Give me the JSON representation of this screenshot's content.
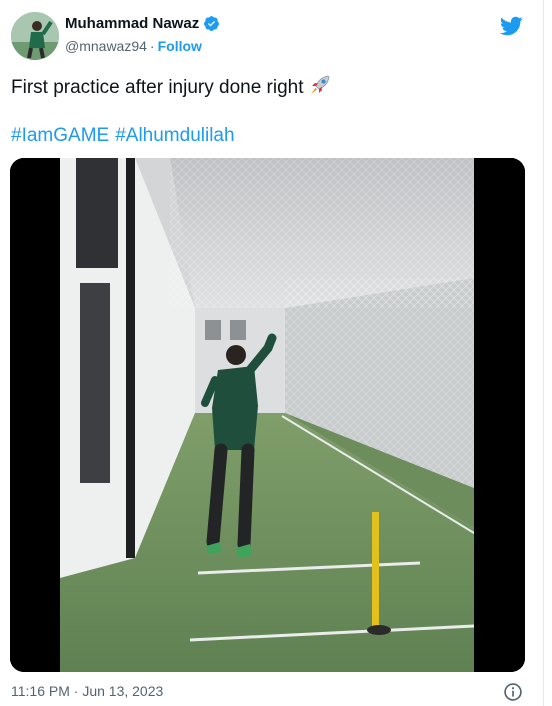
{
  "author": {
    "name": "Muhammad Nawaz",
    "handle": "@mnawaz94",
    "follow_label": "Follow",
    "verified": true
  },
  "tweet": {
    "text": "First practice after injury done right",
    "emoji": "rocket-icon",
    "hashtags": [
      "#IamGAME",
      "#Alhumdulilah"
    ]
  },
  "meta": {
    "timestamp": "11:16 PM · Jun 13, 2023"
  },
  "icons": {
    "brand": "twitter-bird-icon",
    "info": "info-icon"
  },
  "colors": {
    "accent": "#1d9bf0",
    "text": "#0f1419",
    "muted": "#536471"
  }
}
